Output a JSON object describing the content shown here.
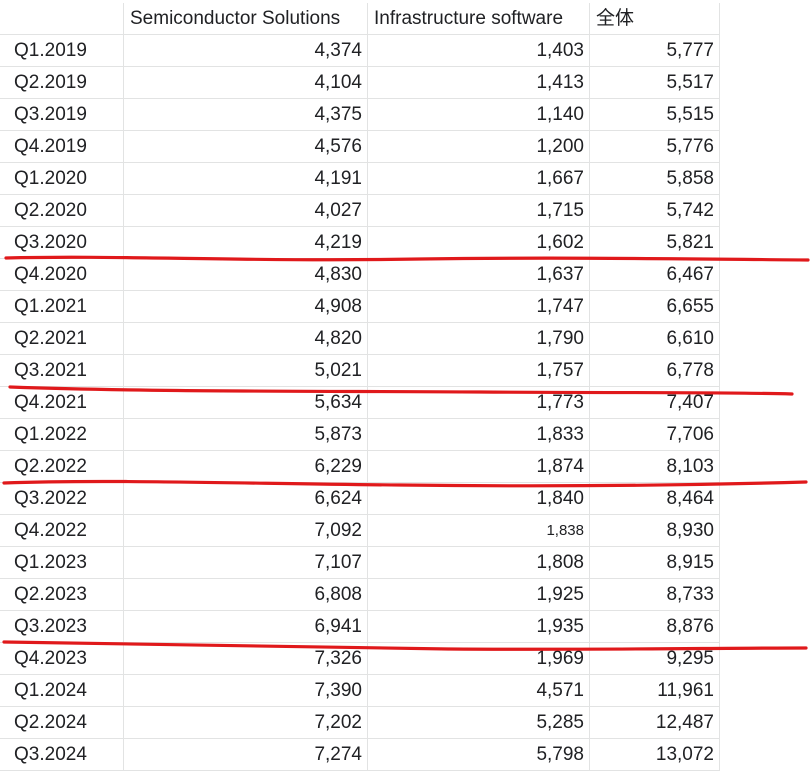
{
  "table": {
    "headers": [
      "",
      "Semiconductor Solutions",
      "Infrastructure software",
      "全体"
    ],
    "rows": [
      [
        "Q1.2019",
        "4,374",
        "1,403",
        "5,777"
      ],
      [
        "Q2.2019",
        "4,104",
        "1,413",
        "5,517"
      ],
      [
        "Q3.2019",
        "4,375",
        "1,140",
        "5,515"
      ],
      [
        "Q4.2019",
        "4,576",
        "1,200",
        "5,776"
      ],
      [
        "Q1.2020",
        "4,191",
        "1,667",
        "5,858"
      ],
      [
        "Q2.2020",
        "4,027",
        "1,715",
        "5,742"
      ],
      [
        "Q3.2020",
        "4,219",
        "1,602",
        "5,821"
      ],
      [
        "Q4.2020",
        "4,830",
        "1,637",
        "6,467"
      ],
      [
        "Q1.2021",
        "4,908",
        "1,747",
        "6,655"
      ],
      [
        "Q2.2021",
        "4,820",
        "1,790",
        "6,610"
      ],
      [
        "Q3.2021",
        "5,021",
        "1,757",
        "6,778"
      ],
      [
        "Q4.2021",
        "5,634",
        "1,773",
        "7,407"
      ],
      [
        "Q1.2022",
        "5,873",
        "1,833",
        "7,706"
      ],
      [
        "Q2.2022",
        "6,229",
        "1,874",
        "8,103"
      ],
      [
        "Q3.2022",
        "6,624",
        "1,840",
        "8,464"
      ],
      [
        "Q4.2022",
        "7,092",
        "1,838",
        "8,930"
      ],
      [
        "Q1.2023",
        "7,107",
        "1,808",
        "8,915"
      ],
      [
        "Q2.2023",
        "6,808",
        "1,925",
        "8,733"
      ],
      [
        "Q3.2023",
        "6,941",
        "1,935",
        "8,876"
      ],
      [
        "Q4.2023",
        "7,326",
        "1,969",
        "9,295"
      ],
      [
        "Q1.2024",
        "7,390",
        "4,571",
        "11,961"
      ],
      [
        "Q2.2024",
        "7,202",
        "5,285",
        "12,487"
      ],
      [
        "Q3.2024",
        "7,274",
        "5,798",
        "13,072"
      ]
    ]
  },
  "annotations": {
    "color": "#e0191b",
    "underlines_after_periods": [
      "Q3.2020",
      "Q3.2021",
      "Q2.2022",
      "Q3.2023"
    ]
  }
}
